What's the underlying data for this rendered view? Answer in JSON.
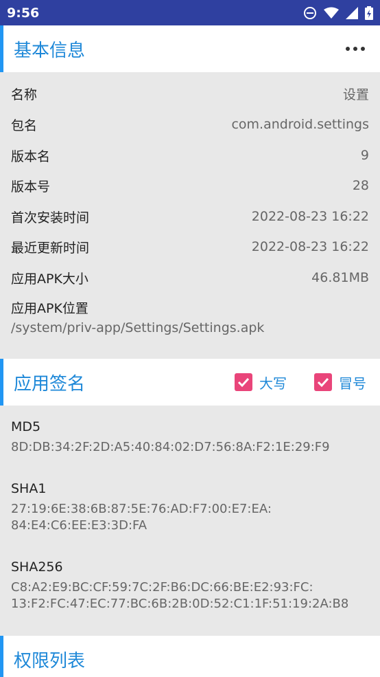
{
  "status_bar": {
    "time": "9:56"
  },
  "basic_info": {
    "title": "基本信息",
    "rows": [
      {
        "label": "名称",
        "value": "设置"
      },
      {
        "label": "包名",
        "value": "com.android.settings"
      },
      {
        "label": "版本名",
        "value": "9"
      },
      {
        "label": "版本号",
        "value": "28"
      },
      {
        "label": "首次安装时间",
        "value": "2022-08-23 16:22"
      },
      {
        "label": "最近更新时间",
        "value": "2022-08-23 16:22"
      },
      {
        "label": "应用APK大小",
        "value": "46.81MB"
      }
    ],
    "apk_location_label": "应用APK位置",
    "apk_location_value": "/system/priv-app/Settings/Settings.apk"
  },
  "signature": {
    "title": "应用签名",
    "uppercase_label": "大写",
    "uppercase_checked": true,
    "colon_label": "冒号",
    "colon_checked": true,
    "items": [
      {
        "name": "MD5",
        "value": "8D:DB:34:2F:2D:A5:40:84:02:D7:56:8A:F2:1E:29:F9"
      },
      {
        "name": "SHA1",
        "value": "27:19:6E:38:6B:87:5E:76:AD:F7:00:E7:EA:\n84:E4:C6:EE:E3:3D:FA"
      },
      {
        "name": "SHA256",
        "value": "C8:A2:E9:BC:CF:59:7C:2F:B6:DC:66:BE:E2:93:FC:\n13:F2:FC:47:EC:77:BC:6B:2B:0D:52:C1:1F:51:19:2A:B8"
      }
    ]
  },
  "permissions": {
    "title": "权限列表"
  },
  "colors": {
    "accent": "#2196f3",
    "title": "#1e88d8",
    "checkbox": "#e9457a",
    "status_bar": "#2f40a0"
  }
}
